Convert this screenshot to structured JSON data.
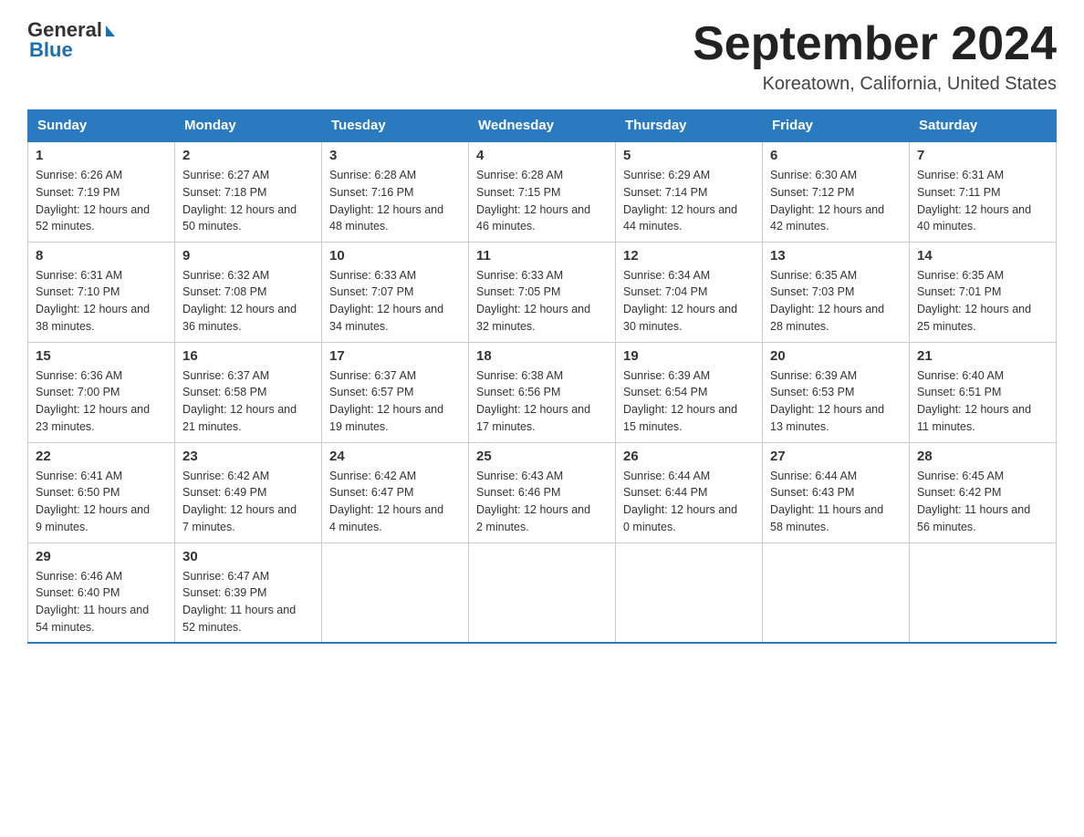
{
  "header": {
    "logo_general": "General",
    "logo_blue": "Blue",
    "month_title": "September 2024",
    "location": "Koreatown, California, United States"
  },
  "weekdays": [
    "Sunday",
    "Monday",
    "Tuesday",
    "Wednesday",
    "Thursday",
    "Friday",
    "Saturday"
  ],
  "weeks": [
    [
      {
        "day": "1",
        "sunrise": "6:26 AM",
        "sunset": "7:19 PM",
        "daylight": "12 hours and 52 minutes."
      },
      {
        "day": "2",
        "sunrise": "6:27 AM",
        "sunset": "7:18 PM",
        "daylight": "12 hours and 50 minutes."
      },
      {
        "day": "3",
        "sunrise": "6:28 AM",
        "sunset": "7:16 PM",
        "daylight": "12 hours and 48 minutes."
      },
      {
        "day": "4",
        "sunrise": "6:28 AM",
        "sunset": "7:15 PM",
        "daylight": "12 hours and 46 minutes."
      },
      {
        "day": "5",
        "sunrise": "6:29 AM",
        "sunset": "7:14 PM",
        "daylight": "12 hours and 44 minutes."
      },
      {
        "day": "6",
        "sunrise": "6:30 AM",
        "sunset": "7:12 PM",
        "daylight": "12 hours and 42 minutes."
      },
      {
        "day": "7",
        "sunrise": "6:31 AM",
        "sunset": "7:11 PM",
        "daylight": "12 hours and 40 minutes."
      }
    ],
    [
      {
        "day": "8",
        "sunrise": "6:31 AM",
        "sunset": "7:10 PM",
        "daylight": "12 hours and 38 minutes."
      },
      {
        "day": "9",
        "sunrise": "6:32 AM",
        "sunset": "7:08 PM",
        "daylight": "12 hours and 36 minutes."
      },
      {
        "day": "10",
        "sunrise": "6:33 AM",
        "sunset": "7:07 PM",
        "daylight": "12 hours and 34 minutes."
      },
      {
        "day": "11",
        "sunrise": "6:33 AM",
        "sunset": "7:05 PM",
        "daylight": "12 hours and 32 minutes."
      },
      {
        "day": "12",
        "sunrise": "6:34 AM",
        "sunset": "7:04 PM",
        "daylight": "12 hours and 30 minutes."
      },
      {
        "day": "13",
        "sunrise": "6:35 AM",
        "sunset": "7:03 PM",
        "daylight": "12 hours and 28 minutes."
      },
      {
        "day": "14",
        "sunrise": "6:35 AM",
        "sunset": "7:01 PM",
        "daylight": "12 hours and 25 minutes."
      }
    ],
    [
      {
        "day": "15",
        "sunrise": "6:36 AM",
        "sunset": "7:00 PM",
        "daylight": "12 hours and 23 minutes."
      },
      {
        "day": "16",
        "sunrise": "6:37 AM",
        "sunset": "6:58 PM",
        "daylight": "12 hours and 21 minutes."
      },
      {
        "day": "17",
        "sunrise": "6:37 AM",
        "sunset": "6:57 PM",
        "daylight": "12 hours and 19 minutes."
      },
      {
        "day": "18",
        "sunrise": "6:38 AM",
        "sunset": "6:56 PM",
        "daylight": "12 hours and 17 minutes."
      },
      {
        "day": "19",
        "sunrise": "6:39 AM",
        "sunset": "6:54 PM",
        "daylight": "12 hours and 15 minutes."
      },
      {
        "day": "20",
        "sunrise": "6:39 AM",
        "sunset": "6:53 PM",
        "daylight": "12 hours and 13 minutes."
      },
      {
        "day": "21",
        "sunrise": "6:40 AM",
        "sunset": "6:51 PM",
        "daylight": "12 hours and 11 minutes."
      }
    ],
    [
      {
        "day": "22",
        "sunrise": "6:41 AM",
        "sunset": "6:50 PM",
        "daylight": "12 hours and 9 minutes."
      },
      {
        "day": "23",
        "sunrise": "6:42 AM",
        "sunset": "6:49 PM",
        "daylight": "12 hours and 7 minutes."
      },
      {
        "day": "24",
        "sunrise": "6:42 AM",
        "sunset": "6:47 PM",
        "daylight": "12 hours and 4 minutes."
      },
      {
        "day": "25",
        "sunrise": "6:43 AM",
        "sunset": "6:46 PM",
        "daylight": "12 hours and 2 minutes."
      },
      {
        "day": "26",
        "sunrise": "6:44 AM",
        "sunset": "6:44 PM",
        "daylight": "12 hours and 0 minutes."
      },
      {
        "day": "27",
        "sunrise": "6:44 AM",
        "sunset": "6:43 PM",
        "daylight": "11 hours and 58 minutes."
      },
      {
        "day": "28",
        "sunrise": "6:45 AM",
        "sunset": "6:42 PM",
        "daylight": "11 hours and 56 minutes."
      }
    ],
    [
      {
        "day": "29",
        "sunrise": "6:46 AM",
        "sunset": "6:40 PM",
        "daylight": "11 hours and 54 minutes."
      },
      {
        "day": "30",
        "sunrise": "6:47 AM",
        "sunset": "6:39 PM",
        "daylight": "11 hours and 52 minutes."
      },
      null,
      null,
      null,
      null,
      null
    ]
  ],
  "labels": {
    "sunrise_prefix": "Sunrise: ",
    "sunset_prefix": "Sunset: ",
    "daylight_prefix": "Daylight: "
  }
}
